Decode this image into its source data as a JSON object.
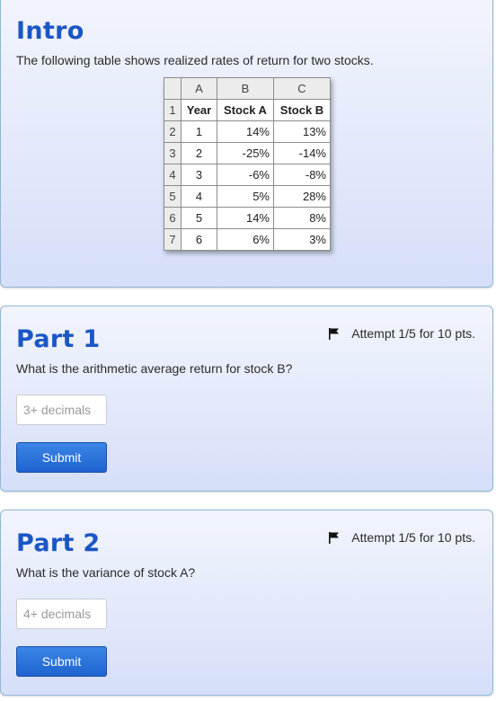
{
  "intro": {
    "title": "Intro",
    "description": "The following table shows realized rates of return for two stocks.",
    "table": {
      "column_letters": [
        "A",
        "B",
        "C"
      ],
      "row_numbers": [
        "1",
        "2",
        "3",
        "4",
        "5",
        "6",
        "7"
      ],
      "headers": [
        "Year",
        "Stock A",
        "Stock B"
      ],
      "rows": [
        [
          "1",
          "14%",
          "13%"
        ],
        [
          "2",
          "-25%",
          "-14%"
        ],
        [
          "3",
          "-6%",
          "-8%"
        ],
        [
          "4",
          "5%",
          "28%"
        ],
        [
          "5",
          "14%",
          "8%"
        ],
        [
          "6",
          "6%",
          "3%"
        ]
      ]
    }
  },
  "parts": [
    {
      "title": "Part 1",
      "attempt": "Attempt 1/5 for 10 pts.",
      "question": "What is the arithmetic average return for stock B?",
      "input_placeholder": "3+ decimals",
      "input_value": "",
      "submit_label": "Submit"
    },
    {
      "title": "Part 2",
      "attempt": "Attempt 1/5 for 10 pts.",
      "question": "What is the variance of stock A?",
      "input_placeholder": "4+ decimals",
      "input_value": "",
      "submit_label": "Submit"
    }
  ],
  "icons": {
    "attempt_flag": "flag-icon"
  },
  "colors": {
    "heading": "#1a56c6",
    "button": "#1f63d0",
    "card_border": "#8fb7d4"
  }
}
